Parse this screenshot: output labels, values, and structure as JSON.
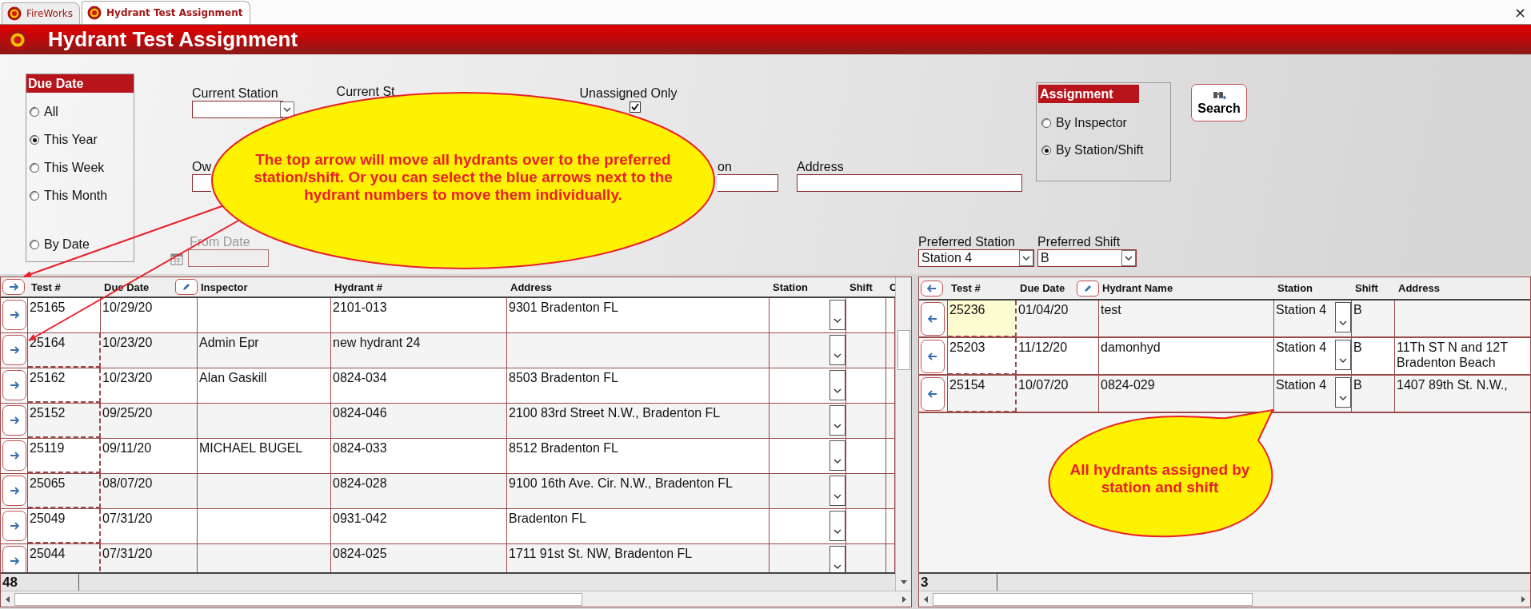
{
  "tabs": [
    {
      "label": "FireWorks",
      "selected": false
    },
    {
      "label": "Hydrant Test Assignment",
      "selected": true
    }
  ],
  "close_button": "×",
  "header": {
    "title": "Hydrant Test Assignment"
  },
  "due_date": {
    "title": "Due Date",
    "options": [
      {
        "label": "All",
        "selected": false
      },
      {
        "label": "This Year",
        "selected": true
      },
      {
        "label": "This Week",
        "selected": false
      },
      {
        "label": "This Month",
        "selected": false
      },
      {
        "label": "By Date",
        "selected": false
      }
    ]
  },
  "filters": {
    "current_station": {
      "label": "Current Station"
    },
    "current_st_label": "Current St",
    "unassigned_only": {
      "label": "Unassigned Only",
      "checked": true
    },
    "owner_label": "Ow",
    "station_label_end": "on",
    "address": {
      "label": "Address"
    },
    "from_date": {
      "label": "From Date",
      "disabled": true
    }
  },
  "assignment": {
    "title": "Assignment",
    "options": [
      {
        "label": "By Inspector",
        "selected": false
      },
      {
        "label": "By Station/Shift",
        "selected": true
      }
    ]
  },
  "search_button": "Search",
  "preferred_station": {
    "label": "Preferred Station",
    "value": "Station 4"
  },
  "preferred_shift": {
    "label": "Preferred Shift",
    "value": "B"
  },
  "left_grid": {
    "columns": [
      "Test #",
      "Due Date",
      "Inspector",
      "Hydrant #",
      "Address",
      "Station",
      "Shift",
      "C"
    ],
    "rows": [
      {
        "test": "25165",
        "due": "10/29/20",
        "hydrant": "2101-013",
        "address": "9301 Bradenton FL"
      },
      {
        "test": "25164",
        "due": "10/23/20",
        "inspector": "Admin Epr",
        "hydrant": "new hydrant 24"
      },
      {
        "test": "25162",
        "due": "10/23/20",
        "inspector": "Alan Gaskill",
        "hydrant": "0824-034",
        "address": "8503 Bradenton FL"
      },
      {
        "test": "25152",
        "due": "09/25/20",
        "hydrant": "0824-046",
        "address": "2100 83rd Street N.W., Bradenton FL"
      },
      {
        "test": "25119",
        "due": "09/11/20",
        "inspector": "MICHAEL BUGEL",
        "hydrant": "0824-033",
        "address": "8512 Bradenton FL"
      },
      {
        "test": "25065",
        "due": "08/07/20",
        "hydrant": "0824-028",
        "address": "9100 16th Ave. Cir. N.W., Bradenton FL"
      },
      {
        "test": "25049",
        "due": "07/31/20",
        "hydrant": "0931-042",
        "address": "Bradenton FL"
      },
      {
        "test": "25044",
        "due": "07/31/20",
        "hydrant": "0824-025",
        "address": "1711 91st St. NW, Bradenton FL"
      }
    ],
    "count": "48"
  },
  "right_grid": {
    "columns": [
      "Test #",
      "Due Date",
      "Hydrant Name",
      "Station",
      "Shift",
      "Address"
    ],
    "rows": [
      {
        "test": "25236",
        "due": "01/04/20",
        "name": "test",
        "station": "Station 4",
        "shift": "B",
        "selected": true
      },
      {
        "test": "25203",
        "due": "11/12/20",
        "name": "damonhyd",
        "station": "Station 4",
        "shift": "B",
        "address": "11Th ST N and 12T\nBradenton Beach",
        "selected": false
      },
      {
        "test": "25154",
        "due": "10/07/20",
        "name": "0824-029",
        "station": "Station 4",
        "shift": "B",
        "address": "1407 89th St. N.W.,",
        "selected": false
      }
    ],
    "count": "3"
  },
  "callouts": [
    {
      "kind": "ellipse",
      "text": "The top arrow will move all hydrants over to the preferred station/shift. Or you can select the blue arrows next to the hydrant numbers to move them individually."
    },
    {
      "kind": "bubble",
      "text": "All hydrants assigned by station and shift"
    }
  ]
}
